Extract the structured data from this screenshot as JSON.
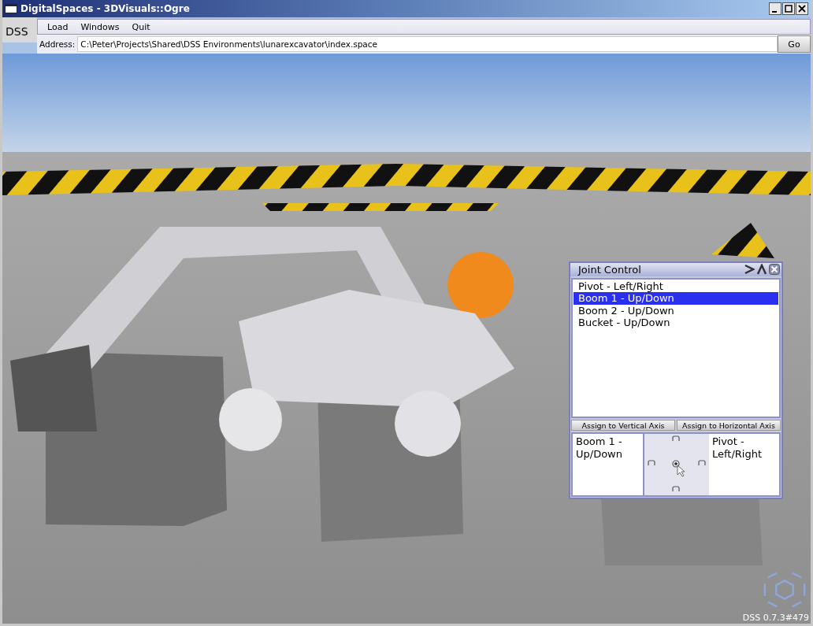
{
  "window": {
    "title": "DigitalSpaces - 3DVisuals::Ogre"
  },
  "logo_label": "DSS",
  "menu": [
    {
      "label": "Load"
    },
    {
      "label": "Windows"
    },
    {
      "label": "Quit"
    }
  ],
  "address": {
    "label": "Address:",
    "value": "C:\\Peter\\Projects\\Shared\\DSS Environments\\lunarexcavator\\index.space"
  },
  "go_button": "Go",
  "joint_control": {
    "title": "Joint Control",
    "joints": [
      {
        "label": "Pivot - Left/Right",
        "selected": false
      },
      {
        "label": "Boom 1 - Up/Down",
        "selected": true
      },
      {
        "label": "Boom 2 - Up/Down",
        "selected": false
      },
      {
        "label": "Bucket - Up/Down",
        "selected": false
      }
    ],
    "assign_buttons": [
      "Assign to Vertical Axis",
      "Assign to Horizontal Axis"
    ],
    "vertical_axis": "Boom 1 - Up/Down",
    "horizontal_axis": "Pivot - Left/Right"
  },
  "version": "DSS 0.7.3#479"
}
